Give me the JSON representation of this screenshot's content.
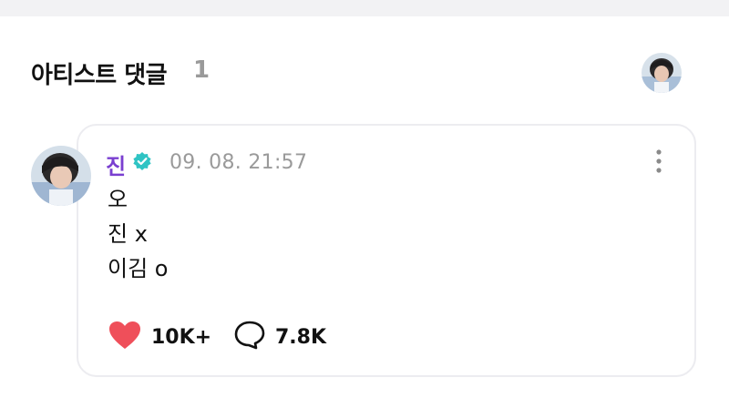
{
  "section": {
    "title": "아티스트 댓글",
    "count": "1"
  },
  "comment": {
    "author": "진",
    "timestamp": "09. 08. 21:57",
    "lines": [
      "오",
      "진 x",
      "이김 o"
    ],
    "likes": "10K+",
    "replies": "7.8K"
  },
  "colors": {
    "author_name": "#7a3fd0",
    "verified_badge": "#2fc4c4",
    "heart": "#ef4f5a",
    "card_border": "#ececf0",
    "muted_text": "#9a9a9a"
  },
  "icons": {
    "verified": "verified-badge-icon",
    "more": "more-vertical-icon",
    "like": "heart-icon",
    "reply": "speech-bubble-icon"
  }
}
